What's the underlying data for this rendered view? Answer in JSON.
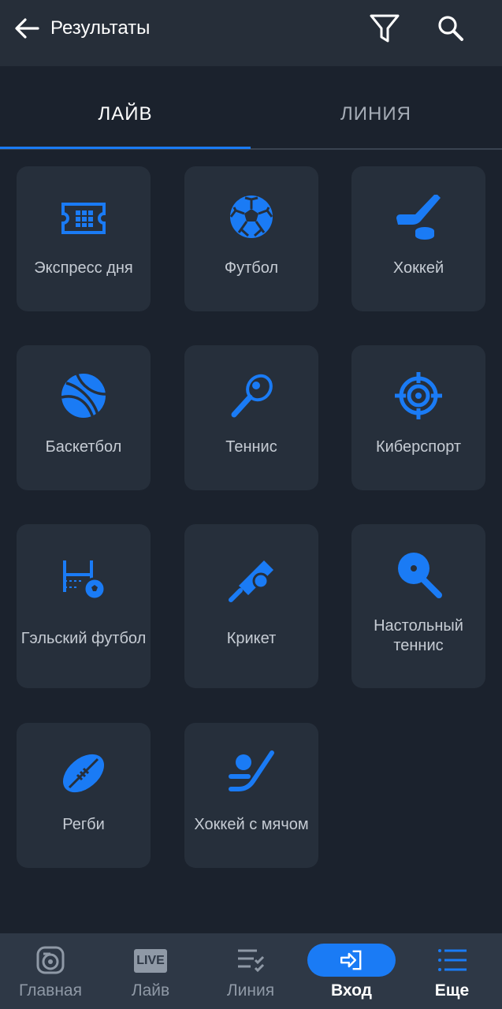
{
  "header": {
    "title": "Результаты",
    "back_icon": "arrow-left-icon",
    "filter_icon": "filter-icon",
    "search_icon": "search-icon"
  },
  "tabs": [
    {
      "label": "ЛАЙВ",
      "active": true
    },
    {
      "label": "ЛИНИЯ",
      "active": false
    }
  ],
  "sports": [
    {
      "label": "Экспресс дня",
      "icon": "ticket-icon"
    },
    {
      "label": "Футбол",
      "icon": "soccer-ball-icon"
    },
    {
      "label": "Хоккей",
      "icon": "hockey-stick-icon"
    },
    {
      "label": "Баскетбол",
      "icon": "basketball-icon"
    },
    {
      "label": "Теннис",
      "icon": "tennis-racket-icon"
    },
    {
      "label": "Киберспорт",
      "icon": "crosshair-icon"
    },
    {
      "label": "Гэльский футбол",
      "icon": "gaelic-goal-icon"
    },
    {
      "label": "Крикет",
      "icon": "cricket-bat-icon"
    },
    {
      "label": "Настольный теннис",
      "icon": "table-tennis-icon"
    },
    {
      "label": "Регби",
      "icon": "rugby-ball-icon"
    },
    {
      "label": "Хоккей с мячом",
      "icon": "bandy-icon"
    }
  ],
  "bottom_nav": [
    {
      "label": "Главная",
      "icon": "home-ball-icon"
    },
    {
      "label": "Лайв",
      "icon": "live-icon",
      "icon_text": "LIVE"
    },
    {
      "label": "Линия",
      "icon": "checklist-icon"
    },
    {
      "label": "Вход",
      "icon": "login-icon"
    },
    {
      "label": "Еще",
      "icon": "menu-icon",
      "active": true
    }
  ],
  "colors": {
    "accent": "#1a7bf5",
    "background": "#1b222d",
    "card": "#262f3b",
    "header": "#262e39",
    "bottom_bar": "#2e3846"
  }
}
